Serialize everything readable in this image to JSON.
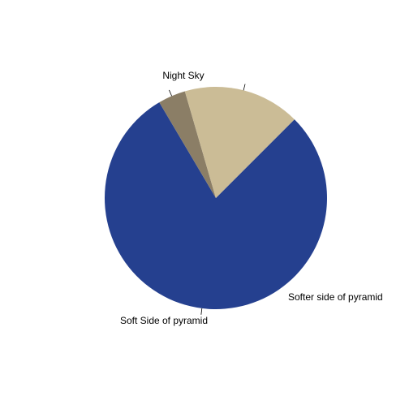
{
  "chart_data": {
    "type": "pie",
    "title": "",
    "slices": [
      {
        "label": "Night Sky",
        "value": 0.79,
        "color": "#25408F"
      },
      {
        "label": "Softer side of pyramid",
        "value": 0.04,
        "color": "#8B7E66"
      },
      {
        "label": "Soft Side of pyramid",
        "value": 0.17,
        "color": "#CBBC96"
      }
    ],
    "start_angle_deg": 45,
    "direction": "clockwise"
  }
}
